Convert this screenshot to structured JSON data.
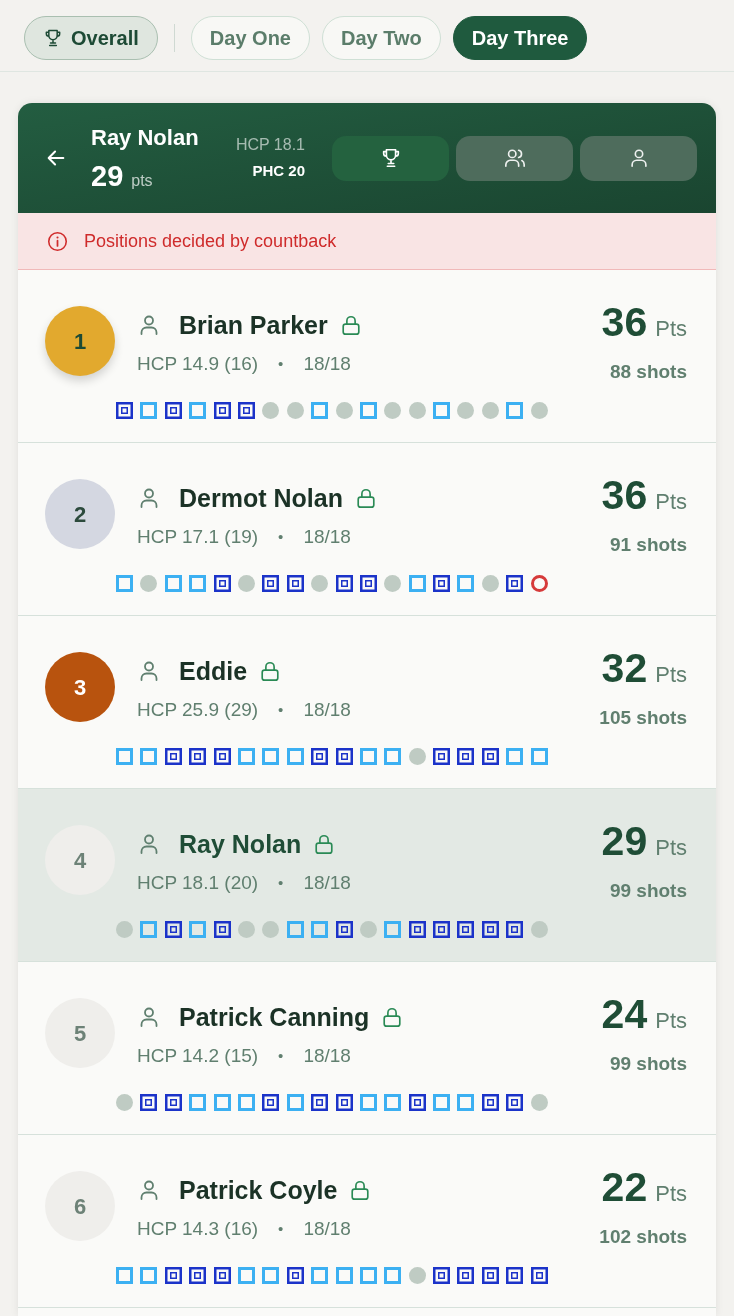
{
  "tabs": [
    {
      "kind": "overall",
      "label": "Overall",
      "selected": false
    },
    {
      "kind": "day",
      "label": "Day One",
      "selected": false
    },
    {
      "kind": "day",
      "label": "Day Two",
      "selected": false
    },
    {
      "kind": "day",
      "label": "Day Three",
      "selected": true
    }
  ],
  "player_header": {
    "name": "Ray Nolan",
    "points": "29",
    "points_unit": "pts",
    "handicap": "HCP 18.1",
    "playing_handicap": "PHC 20",
    "views": [
      {
        "kind": "trophy",
        "selected": true
      },
      {
        "kind": "group",
        "selected": false
      },
      {
        "kind": "person",
        "selected": false
      }
    ]
  },
  "notice": {
    "text": "Positions decided by countback"
  },
  "leaderboard": [
    {
      "rank": "1",
      "kind": "gold",
      "selected": false,
      "name": "Brian Parker",
      "locked": true,
      "handicap": "HCP 14.9 (16)",
      "separator": "•",
      "holes_played": "18/18",
      "points": "36",
      "points_unit": "Pts",
      "shots": "88 shots",
      "holes": [
        {
          "kind": "double"
        },
        {
          "kind": "square"
        },
        {
          "kind": "double"
        },
        {
          "kind": "square"
        },
        {
          "kind": "double"
        },
        {
          "kind": "double"
        },
        {
          "kind": "dot"
        },
        {
          "kind": "dot"
        },
        {
          "kind": "square"
        },
        {
          "kind": "dot"
        },
        {
          "kind": "square"
        },
        {
          "kind": "dot"
        },
        {
          "kind": "dot"
        },
        {
          "kind": "square"
        },
        {
          "kind": "dot"
        },
        {
          "kind": "dot"
        },
        {
          "kind": "square"
        },
        {
          "kind": "dot"
        }
      ]
    },
    {
      "rank": "2",
      "kind": "silver",
      "selected": false,
      "name": "Dermot Nolan",
      "locked": true,
      "handicap": "HCP 17.1 (19)",
      "separator": "•",
      "holes_played": "18/18",
      "points": "36",
      "points_unit": "Pts",
      "shots": "91 shots",
      "holes": [
        {
          "kind": "square"
        },
        {
          "kind": "dot"
        },
        {
          "kind": "square"
        },
        {
          "kind": "square"
        },
        {
          "kind": "double"
        },
        {
          "kind": "dot"
        },
        {
          "kind": "double"
        },
        {
          "kind": "double"
        },
        {
          "kind": "dot"
        },
        {
          "kind": "double"
        },
        {
          "kind": "double"
        },
        {
          "kind": "dot"
        },
        {
          "kind": "square"
        },
        {
          "kind": "double"
        },
        {
          "kind": "square"
        },
        {
          "kind": "dot"
        },
        {
          "kind": "double"
        },
        {
          "kind": "ring"
        }
      ]
    },
    {
      "rank": "3",
      "kind": "bronze",
      "selected": false,
      "name": "Eddie",
      "locked": true,
      "handicap": "HCP 25.9 (29)",
      "separator": "•",
      "holes_played": "18/18",
      "points": "32",
      "points_unit": "Pts",
      "shots": "105 shots",
      "holes": [
        {
          "kind": "square"
        },
        {
          "kind": "square"
        },
        {
          "kind": "double"
        },
        {
          "kind": "double"
        },
        {
          "kind": "double"
        },
        {
          "kind": "square"
        },
        {
          "kind": "square"
        },
        {
          "kind": "square"
        },
        {
          "kind": "double"
        },
        {
          "kind": "double"
        },
        {
          "kind": "square"
        },
        {
          "kind": "square"
        },
        {
          "kind": "dot"
        },
        {
          "kind": "double"
        },
        {
          "kind": "double"
        },
        {
          "kind": "double"
        },
        {
          "kind": "square"
        },
        {
          "kind": "square"
        }
      ]
    },
    {
      "rank": "4",
      "kind": "plain",
      "selected": true,
      "name": "Ray Nolan",
      "locked": true,
      "handicap": "HCP 18.1 (20)",
      "separator": "•",
      "holes_played": "18/18",
      "points": "29",
      "points_unit": "Pts",
      "shots": "99 shots",
      "holes": [
        {
          "kind": "dot"
        },
        {
          "kind": "square"
        },
        {
          "kind": "double"
        },
        {
          "kind": "square"
        },
        {
          "kind": "double"
        },
        {
          "kind": "dot"
        },
        {
          "kind": "dot"
        },
        {
          "kind": "square"
        },
        {
          "kind": "square"
        },
        {
          "kind": "double"
        },
        {
          "kind": "dot"
        },
        {
          "kind": "square"
        },
        {
          "kind": "double"
        },
        {
          "kind": "double"
        },
        {
          "kind": "double"
        },
        {
          "kind": "double"
        },
        {
          "kind": "double"
        },
        {
          "kind": "dot"
        }
      ]
    },
    {
      "rank": "5",
      "kind": "plain",
      "selected": false,
      "name": "Patrick Canning",
      "locked": true,
      "handicap": "HCP 14.2 (15)",
      "separator": "•",
      "holes_played": "18/18",
      "points": "24",
      "points_unit": "Pts",
      "shots": "99 shots",
      "holes": [
        {
          "kind": "dot"
        },
        {
          "kind": "double"
        },
        {
          "kind": "double"
        },
        {
          "kind": "square"
        },
        {
          "kind": "square"
        },
        {
          "kind": "square"
        },
        {
          "kind": "double"
        },
        {
          "kind": "square"
        },
        {
          "kind": "double"
        },
        {
          "kind": "double"
        },
        {
          "kind": "square"
        },
        {
          "kind": "square"
        },
        {
          "kind": "double"
        },
        {
          "kind": "square"
        },
        {
          "kind": "square"
        },
        {
          "kind": "double"
        },
        {
          "kind": "double"
        },
        {
          "kind": "dot"
        }
      ]
    },
    {
      "rank": "6",
      "kind": "plain",
      "selected": false,
      "name": "Patrick Coyle",
      "locked": true,
      "handicap": "HCP 14.3 (16)",
      "separator": "•",
      "holes_played": "18/18",
      "points": "22",
      "points_unit": "Pts",
      "shots": "102 shots",
      "holes": [
        {
          "kind": "square"
        },
        {
          "kind": "square"
        },
        {
          "kind": "double"
        },
        {
          "kind": "double"
        },
        {
          "kind": "double"
        },
        {
          "kind": "square"
        },
        {
          "kind": "square"
        },
        {
          "kind": "double"
        },
        {
          "kind": "square"
        },
        {
          "kind": "square"
        },
        {
          "kind": "square"
        },
        {
          "kind": "square"
        },
        {
          "kind": "dot"
        },
        {
          "kind": "double"
        },
        {
          "kind": "double"
        },
        {
          "kind": "double"
        },
        {
          "kind": "double"
        },
        {
          "kind": "double"
        }
      ]
    }
  ]
}
